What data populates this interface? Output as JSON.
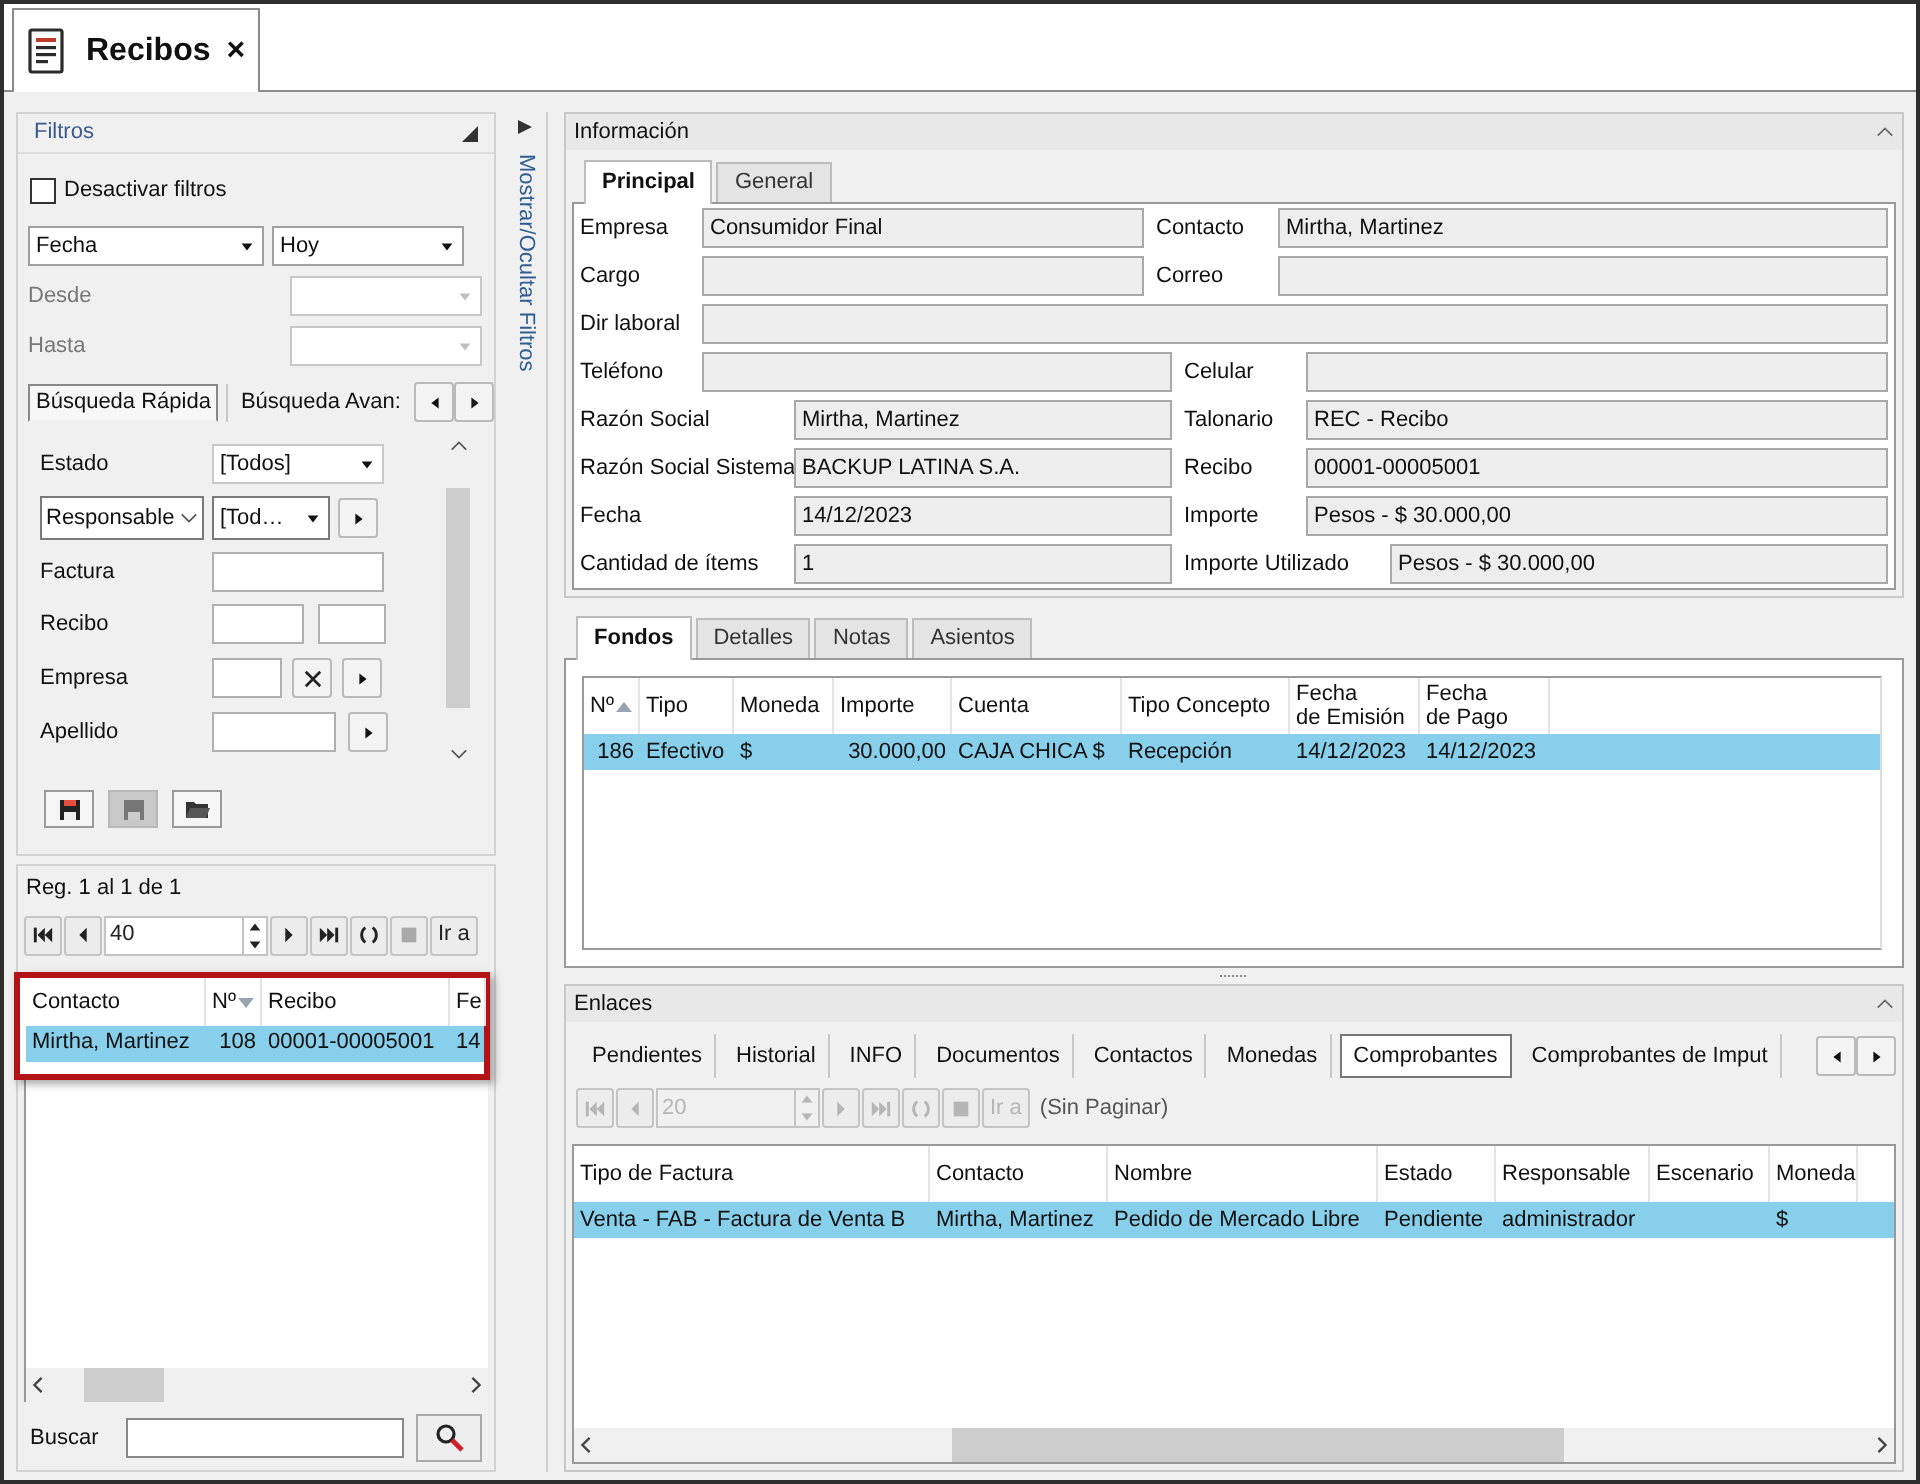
{
  "document_tab": {
    "title": "Recibos",
    "close": "×"
  },
  "filters": {
    "title": "Filtros",
    "disable_filters": {
      "label": "Desactivar filtros",
      "checked": false
    },
    "date_field": "Fecha",
    "date_range": "Hoy",
    "from_label": "Desde",
    "to_label": "Hasta",
    "search_tabs": [
      {
        "label": "Búsqueda Rápida",
        "selected": true
      },
      {
        "label": "Búsqueda Avan:",
        "selected": false
      }
    ],
    "quick_fields": [
      {
        "kind": "combo",
        "label": "Estado",
        "value": "[Todos]"
      },
      {
        "kind": "select",
        "label": "Responsable",
        "value": "[Tod…"
      },
      {
        "kind": "text",
        "label": "Factura"
      },
      {
        "kind": "pair",
        "label": "Recibo"
      },
      {
        "kind": "clear",
        "label": "Empresa"
      },
      {
        "kind": "lookup",
        "label": "Apellido"
      }
    ]
  },
  "toggle_filters": "Mostrar/Ocultar Filtros",
  "results": {
    "record_info": "Reg. 1 al 1 de 1",
    "page_size": "40",
    "goto": "Ir a",
    "sort_descending": true,
    "columns": [
      {
        "label": "Contacto",
        "sorted": false
      },
      {
        "label": "Nº",
        "sorted": true
      },
      {
        "label": "Recibo",
        "sorted": false
      },
      {
        "label": "Fe",
        "sorted": false
      }
    ],
    "rows": [
      {
        "cells": [
          "Mirtha, Martinez",
          "108",
          "00001-00005001",
          "14"
        ],
        "selected": true
      }
    ],
    "search_label": "Buscar"
  },
  "info": {
    "title": "Información",
    "tabs": [
      {
        "label": "Principal",
        "selected": true
      },
      {
        "label": "General",
        "selected": false
      }
    ],
    "rows": [
      [
        {
          "label": "Empresa",
          "value": "Consumidor Final"
        },
        {
          "label": "Contacto",
          "value": "Mirtha, Martinez"
        }
      ],
      [
        {
          "label": "Cargo"
        },
        {
          "label": "Correo"
        }
      ],
      [
        {
          "label": "Dir laboral"
        }
      ],
      [
        {
          "label": "Teléfono"
        },
        {
          "label": "Celular"
        }
      ],
      [
        {
          "label": "Razón Social",
          "value": "Mirtha, Martinez"
        },
        {
          "label": "Talonario",
          "value": "REC - Recibo"
        }
      ],
      [
        {
          "label": "Razón Social Sistema",
          "value": "BACKUP LATINA S.A."
        },
        {
          "label": "Recibo",
          "value": "00001-00005001"
        }
      ],
      [
        {
          "label": "Fecha",
          "value": "14/12/2023"
        },
        {
          "label": "Importe",
          "value": "Pesos - $ 30.000,00"
        }
      ],
      [
        {
          "label": "Cantidad de ítems",
          "value": "1"
        },
        {
          "label": "Importe Utilizado",
          "value": "Pesos - $ 30.000,00"
        }
      ]
    ]
  },
  "fondos": {
    "tabs": [
      {
        "label": "Fondos",
        "selected": true
      },
      {
        "label": "Detalles",
        "selected": false
      },
      {
        "label": "Notas",
        "selected": false
      },
      {
        "label": "Asientos",
        "selected": false
      }
    ],
    "sort_descending": false,
    "columns": [
      {
        "label": "Nº",
        "sorted": true
      },
      {
        "label": "Tipo",
        "sorted": false
      },
      {
        "label": "Moneda",
        "sorted": false
      },
      {
        "label": "Importe",
        "sorted": false
      },
      {
        "label": "Cuenta",
        "sorted": false
      },
      {
        "label": "Tipo Concepto",
        "sorted": false
      },
      {
        "label": "Fecha\nde Emisión",
        "sorted": false
      },
      {
        "label": "Fecha\nde Pago",
        "sorted": false
      }
    ],
    "rows": [
      {
        "cells": [
          "186",
          "Efectivo",
          "$",
          "30.000,00",
          "CAJA CHICA $",
          "Recepción",
          "14/12/2023",
          "14/12/2023"
        ],
        "selected": true
      }
    ]
  },
  "enlaces": {
    "title": "Enlaces",
    "tabs": [
      {
        "label": "Pendientes",
        "selected": false
      },
      {
        "label": "Historial",
        "selected": false
      },
      {
        "label": "INFO",
        "selected": false
      },
      {
        "label": "Documentos",
        "selected": false
      },
      {
        "label": "Contactos",
        "selected": false
      },
      {
        "label": "Monedas",
        "selected": false
      },
      {
        "label": "Comprobantes",
        "selected": true
      },
      {
        "label": "Comprobantes de Imput",
        "selected": false
      }
    ],
    "pager": {
      "disabled": true,
      "page_size": "20",
      "goto": "Ir a",
      "note": "(Sin Paginar)"
    },
    "columns": [
      {
        "label": "Tipo de Factura"
      },
      {
        "label": "Contacto"
      },
      {
        "label": "Nombre"
      },
      {
        "label": "Estado"
      },
      {
        "label": "Responsable"
      },
      {
        "label": "Escenario"
      },
      {
        "label": "Moneda"
      }
    ],
    "rows": [
      {
        "cells": [
          "Venta - FAB - Factura de Venta B",
          "Mirtha, Martinez",
          "Pedido de Mercado Libre",
          "Pendiente",
          "administrador",
          "",
          "$"
        ],
        "selected": true
      }
    ]
  }
}
